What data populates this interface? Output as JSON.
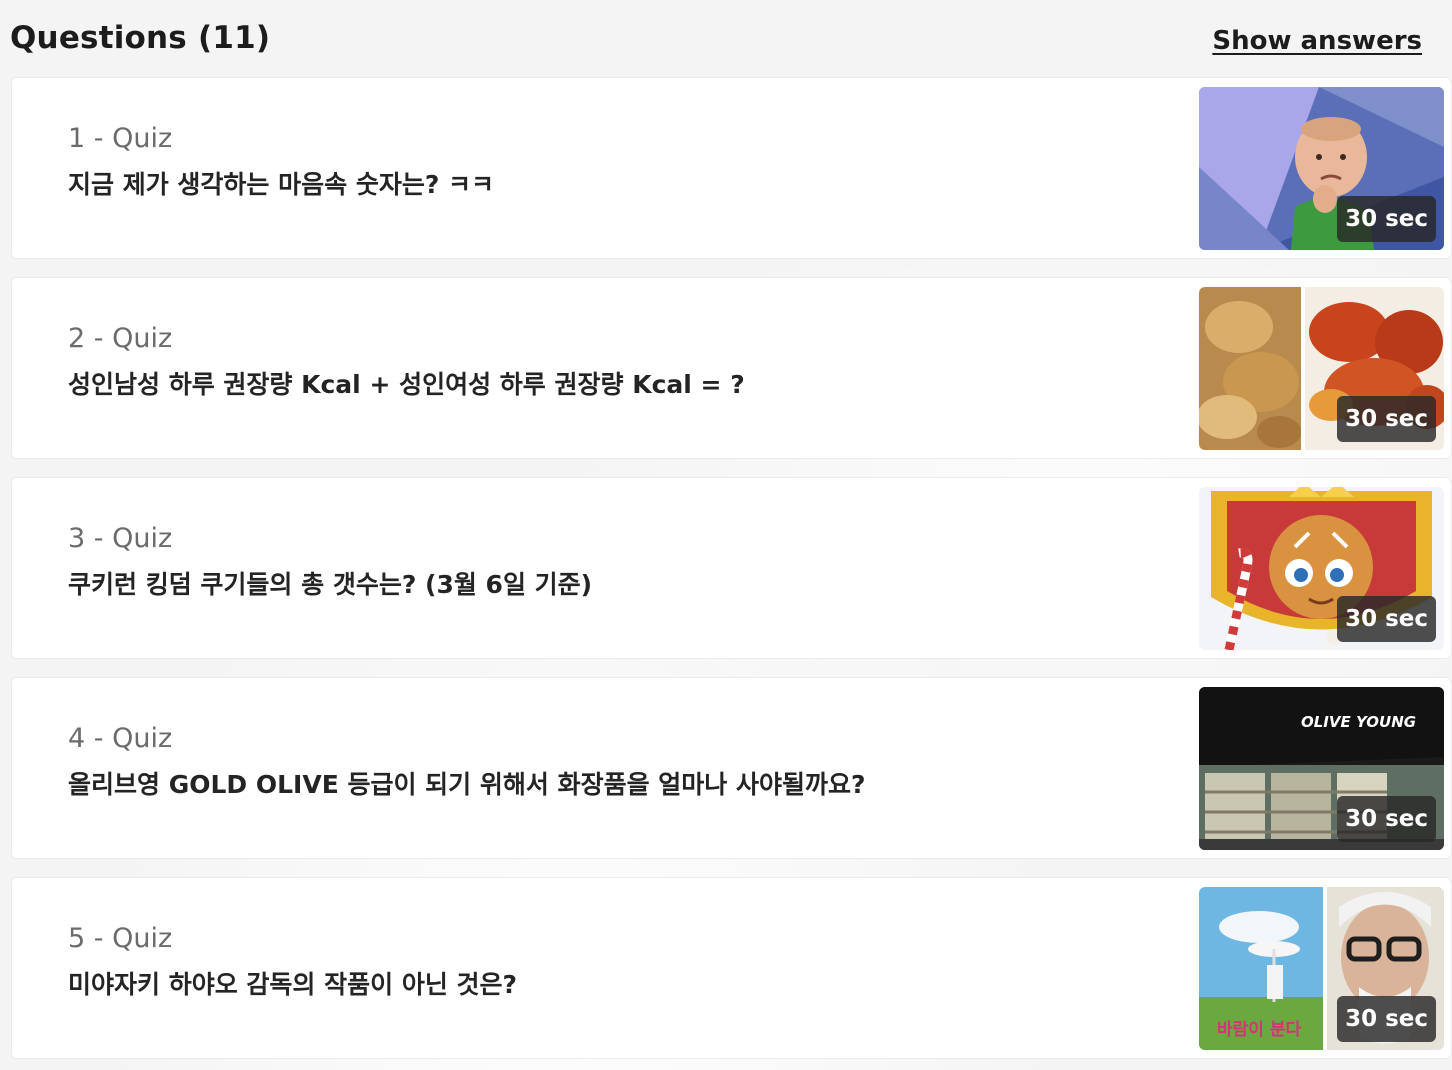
{
  "header": {
    "title": "Questions (11)",
    "show_answers_label": "Show answers"
  },
  "questions": [
    {
      "label": "1 - Quiz",
      "text": "지금 제가 생각하는 마음속 숫자는? ㅋㅋ",
      "time": "30 sec",
      "image": "success-kid-meme-image"
    },
    {
      "label": "2 - Quiz",
      "text": "성인남성 하루 권장량 Kcal + 성인여성 하루 권장량 Kcal = ?",
      "time": "30 sec",
      "image": "fried-chicken-image"
    },
    {
      "label": "3 - Quiz",
      "text": "쿠키런 킹덤 쿠기들의 총 갯수는? (3월 6일 기준)",
      "time": "30 sec",
      "image": "cookie-run-kingdom-image"
    },
    {
      "label": "4 - Quiz",
      "text": "올리브영 GOLD OLIVE 등급이 되기 위해서 화장품을 얼마나 사야될까요?",
      "time": "30 sec",
      "image": "olive-young-store-image",
      "image_sign_text": "OLIVE YOUNG"
    },
    {
      "label": "5 - Quiz",
      "text": "미야자키 하야오 감독의 작품이 아닌 것은?",
      "time": "30 sec",
      "image": "miyazaki-poster-image",
      "image_poster_text": "바람이 분다"
    }
  ]
}
